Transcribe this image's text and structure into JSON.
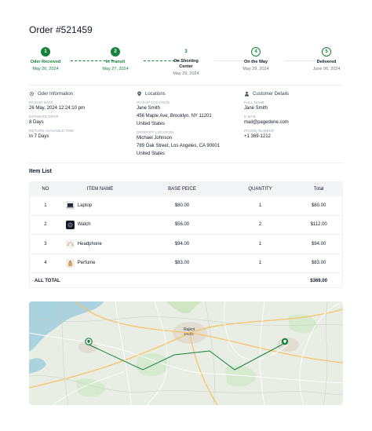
{
  "order": {
    "title": "Order #521459"
  },
  "stepper": [
    {
      "num": "1",
      "label": "Oder Received",
      "date": "May 26, 2024",
      "state": "done"
    },
    {
      "num": "2",
      "label": "In Transit",
      "date": "May 27, 2024",
      "state": "done"
    },
    {
      "num": "3",
      "label": "On Shorting Center",
      "date": "May 29, 2024",
      "state": "current"
    },
    {
      "num": "4",
      "label": "On the Way",
      "date": "May 29, 2024",
      "state": "todo"
    },
    {
      "num": "5",
      "label": "Delivered",
      "date": "June 06, 2024",
      "state": "todo"
    }
  ],
  "details": {
    "heading": "Oder Information",
    "pickup_label": "PICKUP DATE",
    "pickup_value": "26 May, 2024 12:24:10 pm",
    "estimate_label": "ESTIMATE DROP",
    "estimate_value": "8 Days",
    "return_label": "RETURN AVAILABLE TIME",
    "return_value": "In 7 Days"
  },
  "locations": {
    "heading": "Locations",
    "pickup_label": "PICKUP LOCATION",
    "pickup_name": "Jane Smith",
    "pickup_address": "456 Maple Ave, Brooklyn, NY 11201",
    "pickup_country": "United States",
    "dropoff_label": "DROPOFF LOCATION",
    "dropoff_name": "Michael Johnson",
    "dropoff_address": "789 Oak Street, Los Angeles, CA 90001",
    "dropoff_country": "United States"
  },
  "customer": {
    "heading": "Customer Details",
    "name_label": "FULL NAME",
    "name_value": "Jane Smith",
    "email_label": "E-MAIL",
    "email_value": "mail@pagedone.com",
    "phone_label": "PHONE NUMBER",
    "phone_value": "+1 369-1212"
  },
  "items": {
    "title": "Item List",
    "headers": {
      "no": "NO",
      "item": "ITEM NAME",
      "price": "BASE PEICE",
      "qty": "QUANTITY",
      "total": "Total"
    },
    "rows": [
      {
        "no": "1",
        "name": "Laptop",
        "price": "$80.00",
        "qty": "1",
        "total": "$80.00",
        "icon": "laptop-thumb"
      },
      {
        "no": "2",
        "name": "Watch",
        "price": "$56.00",
        "qty": "2",
        "total": "$112.00",
        "icon": "watch-thumb"
      },
      {
        "no": "3",
        "name": "Headphone",
        "price": "$94.00",
        "qty": "1",
        "total": "$94.00",
        "icon": "headphone-thumb"
      },
      {
        "no": "4",
        "name": "Perfume",
        "price": "$83.00",
        "qty": "1",
        "total": "$83.00",
        "icon": "perfume-thumb"
      }
    ],
    "footer_label": "ALL TOTAL",
    "footer_total": "$369.00"
  },
  "map": {
    "city_label": "Rajkot",
    "city_sublabel": "રાજકોટ"
  },
  "colors": {
    "accent": "#16803c",
    "muted": "#6b7280",
    "border": "#eef0f2"
  }
}
